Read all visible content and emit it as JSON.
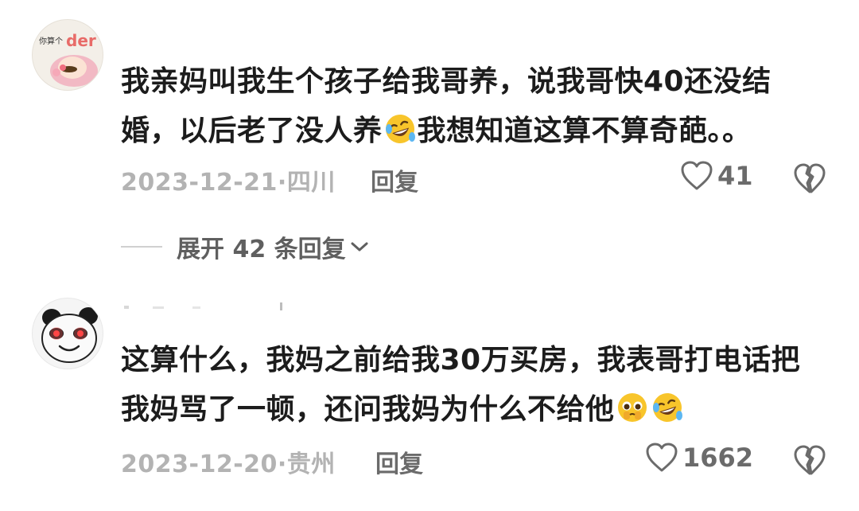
{
  "comments": [
    {
      "avatar_text_small": "你算个",
      "avatar_text_large": "der",
      "text_part1": "我亲妈叫我生个孩子给我哥养，说我哥快40还没结婚，以后老了没人养",
      "text_part2": "我想知道这算不算奇葩。。",
      "emoji_after_part1": "rofl-emoji",
      "date": "2023-12-21",
      "location": "四川",
      "reply_label": "回复",
      "likes": "41",
      "expand_label": "展开 42 条回复"
    },
    {
      "text": "这算什么，我妈之前给我30万买房，我表哥打电话把我妈骂了一顿，还问我妈为什么不给他",
      "emojis": [
        "pleading-emoji",
        "rofl-emoji"
      ],
      "date": "2023-12-20",
      "location": "贵州",
      "reply_label": "回复",
      "likes": "1662"
    }
  ],
  "icons": {
    "like": "heart-outline-icon",
    "dislike": "broken-heart-icon",
    "expand": "chevron-down-icon"
  },
  "colors": {
    "text": "#1c1c1c",
    "meta": "#b3b3b3",
    "action": "#6b6b6b",
    "emoji_yellow": "#f8c52b"
  }
}
